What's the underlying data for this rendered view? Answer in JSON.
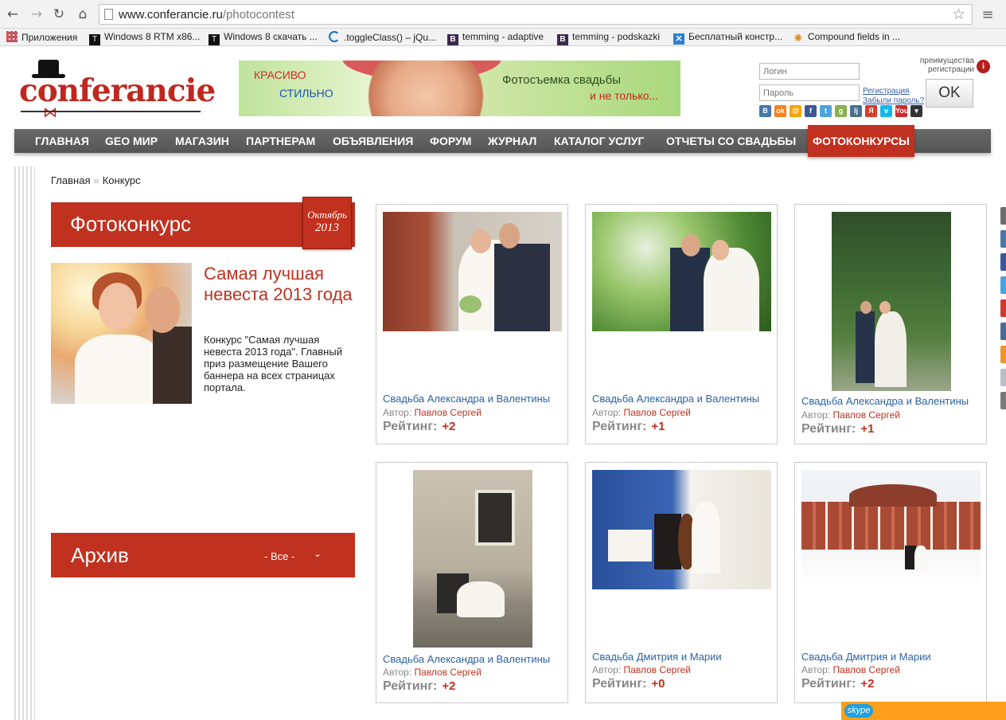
{
  "browser": {
    "url_domain": "www.conferancie.ru",
    "url_path": "/photocontest"
  },
  "bookmarks": [
    {
      "label": "Приложения",
      "icon": "apps-grid-icon"
    },
    {
      "label": "Windows 8 RTM x86...",
      "icon": "t-favicon"
    },
    {
      "label": "Windows 8 скачать ...",
      "icon": "t-favicon"
    },
    {
      "label": ".toggleClass() – jQu...",
      "icon": "jquery-favicon"
    },
    {
      "label": "temming - adaptive",
      "icon": "b-favicon"
    },
    {
      "label": "temming - podskazki",
      "icon": "b-favicon"
    },
    {
      "label": "Бесплатный констр...",
      "icon": "x-favicon"
    },
    {
      "label": "Compound fields in ...",
      "icon": "sun-favicon"
    }
  ],
  "logo": {
    "text": "conferancie"
  },
  "banner": {
    "line1": "КРАСИВО",
    "line2": "СТИЛЬНО",
    "line3": "Фотосъемка свадьбы",
    "line4": "и не только..."
  },
  "login": {
    "login_placeholder": "Логин",
    "password_placeholder": "Пароль",
    "register_link": "Регистрация",
    "forgot_link": "Забыли пароль?",
    "ok_label": "OK",
    "advantages_line1": "преимущества",
    "advantages_line2": "регистрации",
    "info_glyph": "i",
    "social": [
      {
        "name": "vk",
        "glyph": "B",
        "color": "#4a76a8"
      },
      {
        "name": "odnoklassniki",
        "glyph": "ok",
        "color": "#f58220"
      },
      {
        "name": "mail",
        "glyph": "@",
        "color": "#f2a400"
      },
      {
        "name": "facebook",
        "glyph": "f",
        "color": "#3b5998"
      },
      {
        "name": "twitter",
        "glyph": "t",
        "color": "#4aa3df"
      },
      {
        "name": "google",
        "glyph": "g",
        "color": "#88b04b"
      },
      {
        "name": "livejournal",
        "glyph": "lj",
        "color": "#4b6e8d"
      },
      {
        "name": "yandex",
        "glyph": "Я",
        "color": "#d83c2a"
      },
      {
        "name": "vimeo",
        "glyph": "v",
        "color": "#1ab7ea"
      },
      {
        "name": "youtube",
        "glyph": "You",
        "color": "#cc2b2b"
      },
      {
        "name": "more",
        "glyph": "▾",
        "color": "#333333"
      }
    ]
  },
  "nav": {
    "items": [
      {
        "label": "ГЛАВНАЯ",
        "active": false
      },
      {
        "label": "GEO МИР",
        "active": false
      },
      {
        "label": "МАГАЗИН",
        "active": false
      },
      {
        "label": "ПАРТНЕРАМ",
        "active": false
      },
      {
        "label": "ОБЪЯВЛЕНИЯ",
        "active": false
      },
      {
        "label": "ФОРУМ",
        "active": false
      },
      {
        "label": "ЖУРНАЛ",
        "active": false
      },
      {
        "label": "КАТАЛОГ УСЛУГ",
        "active": false
      },
      {
        "label": "ОТЧЕТЫ СО СВАДЬБЫ",
        "active": false
      },
      {
        "label": "ФОТОКОНКУРСЫ",
        "active": true
      }
    ]
  },
  "breadcrumb": {
    "home": "Главная",
    "separator": "»",
    "current": "Конкурс"
  },
  "contest": {
    "title": "Фотоконкурс",
    "month": "Октябрь",
    "year": "2013",
    "feature_title": "Самая лучшая невеста 2013 года",
    "feature_desc": "Конкурс \"Самая лучшая невеста 2013 года\". Главный приз размещение Вашего баннера на всех страницах портала."
  },
  "archive": {
    "title": "Архив",
    "selected": "- Все -"
  },
  "cards": [
    {
      "title": "Свадьба Александра и Валентины",
      "author_label": "Автор:",
      "author": "Павлов Сергей",
      "rating_label": "Рейтинг:",
      "rating": "+2"
    },
    {
      "title": "Свадьба Александра и Валентины",
      "author_label": "Автор:",
      "author": "Павлов Сергей",
      "rating_label": "Рейтинг:",
      "rating": "+1"
    },
    {
      "title": "Свадьба Александра и Валентины",
      "author_label": "Автор:",
      "author": "Павлов Сергей",
      "rating_label": "Рейтинг:",
      "rating": "+1"
    },
    {
      "title": "Свадьба Александра и Валентины",
      "author_label": "Автор:",
      "author": "Павлов Сергей",
      "rating_label": "Рейтинг:",
      "rating": "+2"
    },
    {
      "title": "Свадьба Дмитрия и Марии",
      "author_label": "Автор:",
      "author": "Павлов Сергей",
      "rating_label": "Рейтинг:",
      "rating": "+0"
    },
    {
      "title": "Свадьба Дмитрия и Марии",
      "author_label": "Автор:",
      "author": "Павлов Сергей",
      "rating_label": "Рейтинг:",
      "rating": "+2"
    }
  ],
  "skype": {
    "label": "skype"
  }
}
